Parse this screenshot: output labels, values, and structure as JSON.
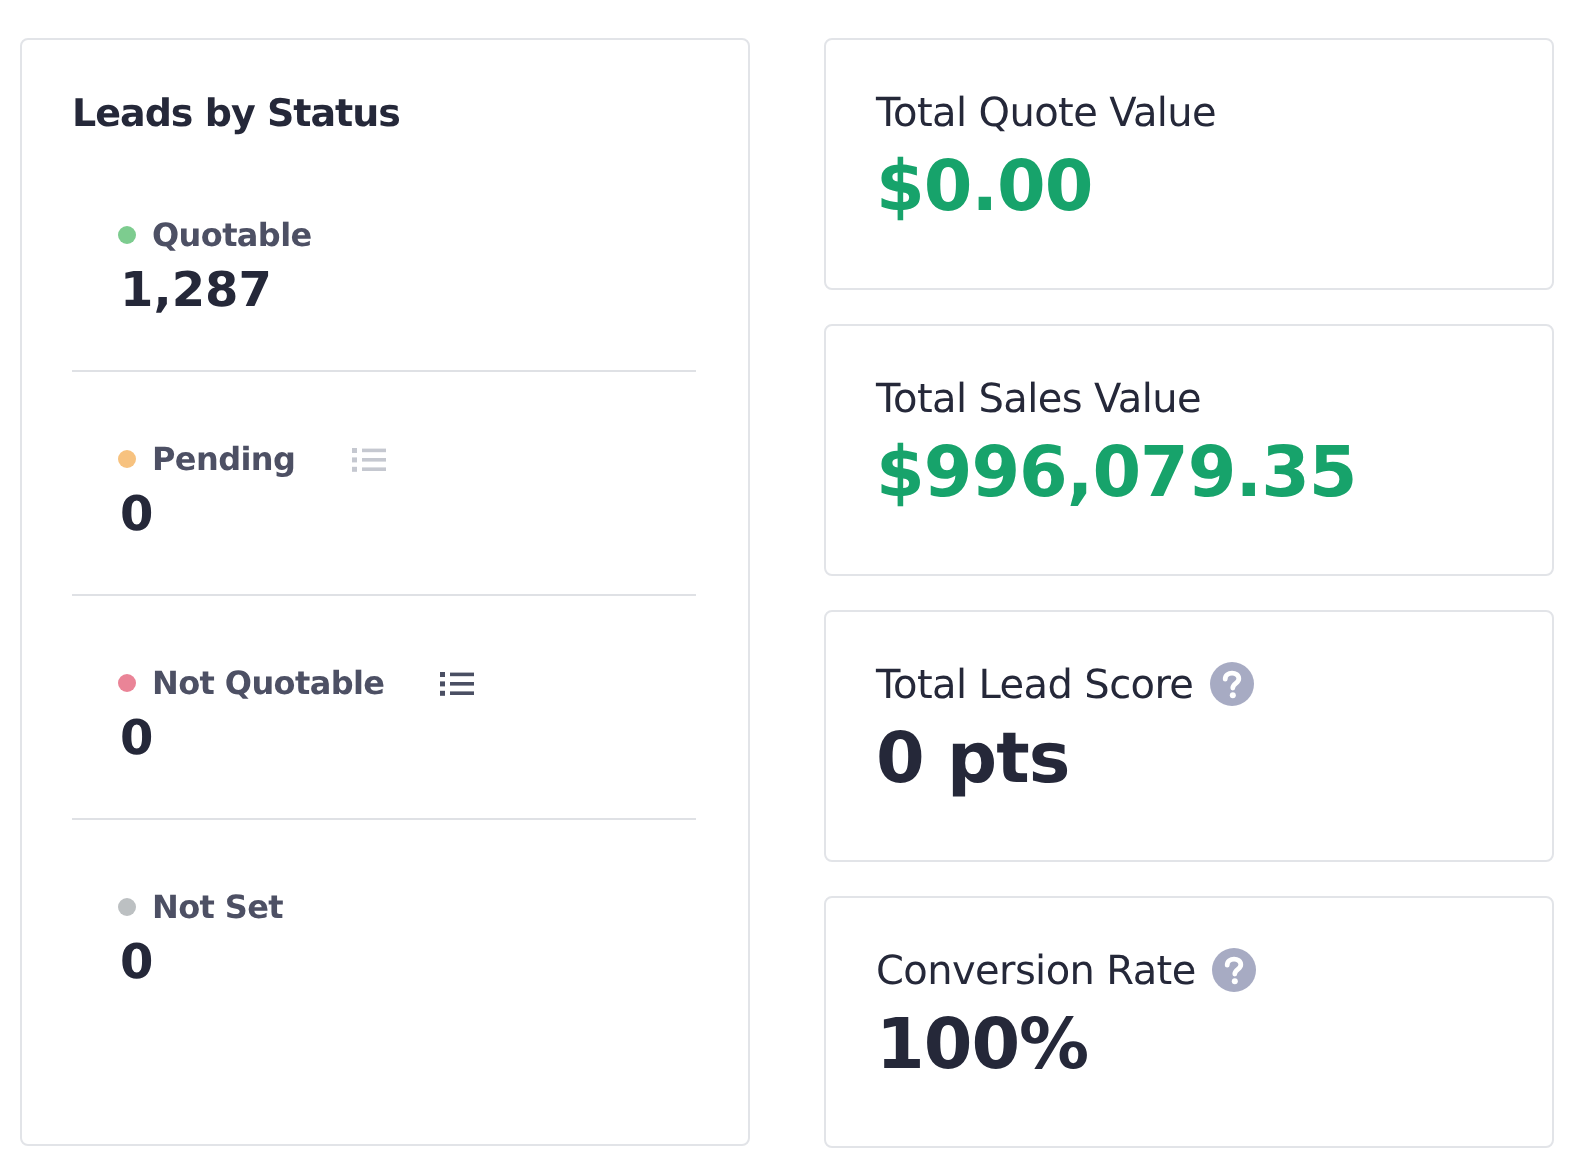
{
  "leads": {
    "title": "Leads by Status",
    "statuses": [
      {
        "label": "Quotable",
        "count": "1,287",
        "color": "#7dcc8f",
        "list_icon": false
      },
      {
        "label": "Pending",
        "count": "0",
        "color": "#f7c27f",
        "list_icon": true,
        "list_active": false
      },
      {
        "label": "Not Quotable",
        "count": "0",
        "color": "#ea8497",
        "list_icon": true,
        "list_active": true
      },
      {
        "label": "Not Set",
        "count": "0",
        "color": "#bcc0c2",
        "list_icon": false
      }
    ]
  },
  "metrics": [
    {
      "label": "Total Quote Value",
      "value": "$0.00",
      "highlight": true,
      "help": false
    },
    {
      "label": "Total Sales Value",
      "value": "$996,079.35",
      "highlight": true,
      "help": false
    },
    {
      "label": "Total Lead Score",
      "value": "0 pts",
      "highlight": false,
      "help": true
    },
    {
      "label": "Conversion Rate",
      "value": "100%",
      "highlight": false,
      "help": true
    }
  ]
}
